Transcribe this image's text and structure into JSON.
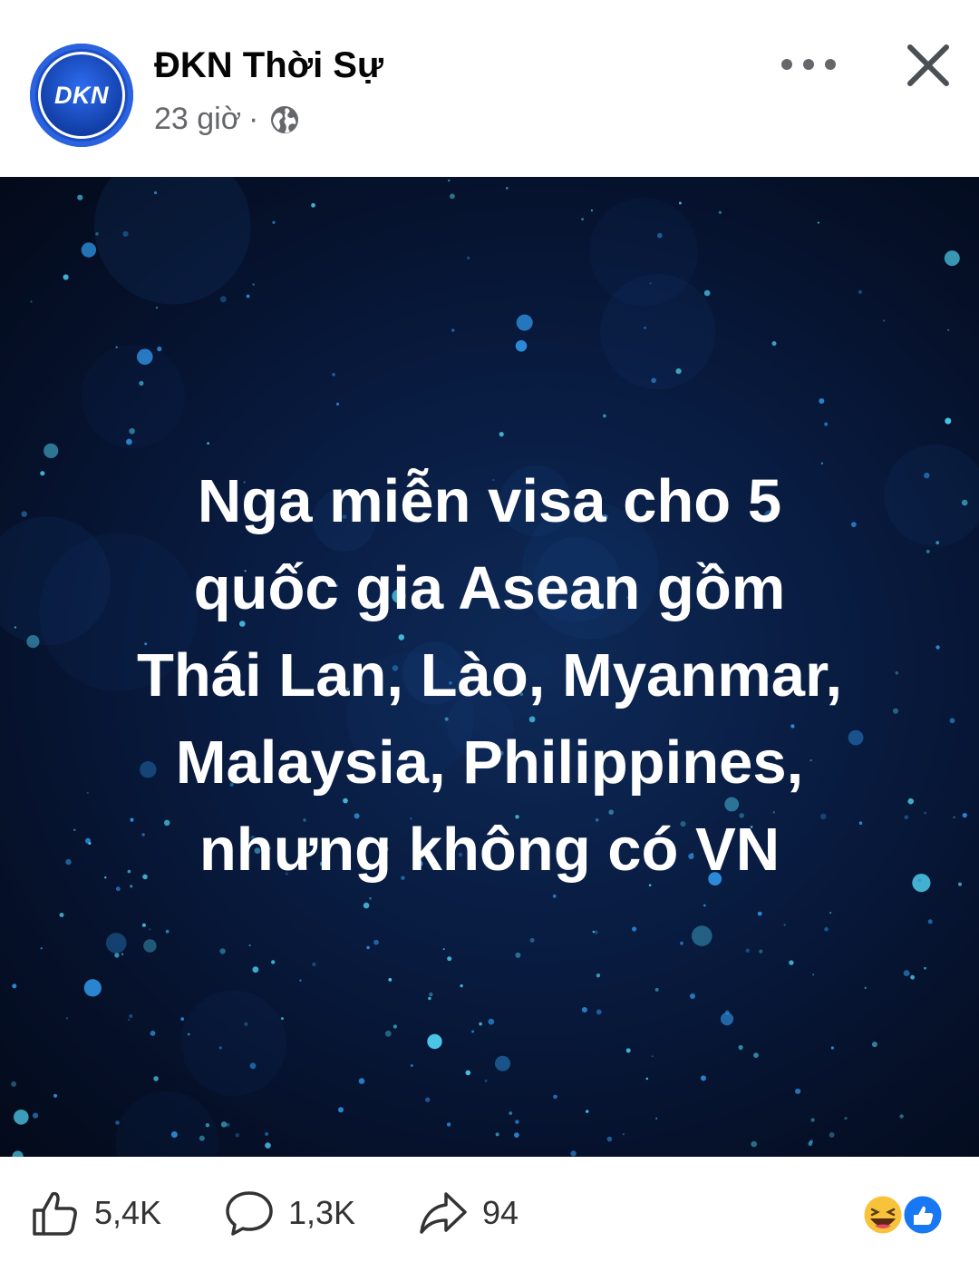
{
  "post": {
    "page_name": "ĐKN Thời Sự",
    "avatar_text": "DKN",
    "time": "23 giờ",
    "separator": "·",
    "icons": {
      "globe": "globe-icon",
      "more": "more-dots-icon",
      "close": "close-icon"
    },
    "image_text": "Nga miễn visa cho 5\nquốc gia Asean gồm\nThái Lan, Lào, Myanmar,\nMalaysia, Philippines,\nnhưng không có VN"
  },
  "footer": {
    "likes": "5,4K",
    "comments": "1,3K",
    "shares": "94",
    "icons": {
      "like": "thumbs-up-icon",
      "comment": "comment-bubble-icon",
      "share": "share-arrow-icon"
    },
    "reactions": [
      "laughing-emoji-icon",
      "like-reaction-icon"
    ]
  },
  "colors": {
    "brand": "#1d4fc4",
    "like_blue": "#1877f2",
    "text_secondary": "#65676b"
  }
}
